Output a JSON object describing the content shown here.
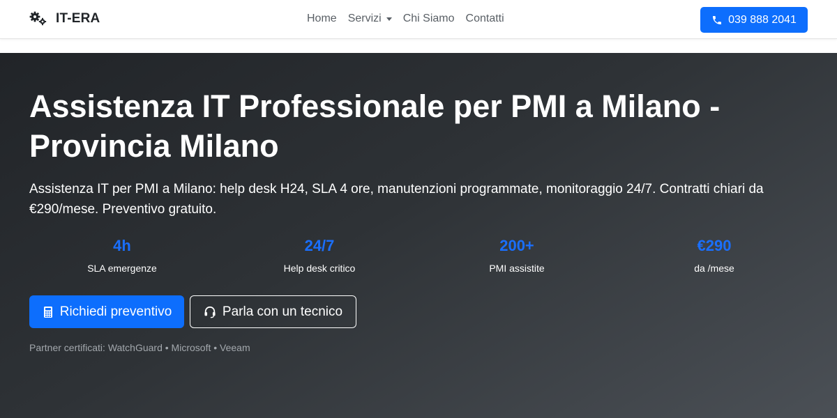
{
  "brand": {
    "name": "IT-ERA",
    "icon": "gears-icon"
  },
  "nav": {
    "home": "Home",
    "servizi": "Servizi",
    "chi_siamo": "Chi Siamo",
    "contatti": "Contatti"
  },
  "phone": {
    "label": "039 888 2041",
    "icon": "phone-icon"
  },
  "hero": {
    "title": "Assistenza IT Professionale per PMI a Milano - Provincia Milano",
    "subtitle": "Assistenza IT per PMI a Milano: help desk H24, SLA 4 ore, manutenzioni programmate, monitoraggio 24/7. Contratti chiari da €290/mese. Preventivo gratuito."
  },
  "stats": [
    {
      "value": "4h",
      "label": "SLA emergenze"
    },
    {
      "value": "24/7",
      "label": "Help desk critico"
    },
    {
      "value": "200+",
      "label": "PMI assistite"
    },
    {
      "value": "€290",
      "label": "da /mese"
    }
  ],
  "cta": {
    "primary": "Richiedi preventivo",
    "primary_icon": "calculator-icon",
    "secondary": "Parla con un tecnico",
    "secondary_icon": "headset-icon"
  },
  "partners": "Partner certificati: WatchGuard • Microsoft • Veeam",
  "colors": {
    "accent": "#0d6efd",
    "stat_value": "#1a6ffd",
    "hero_dark": "#212428",
    "hero_light": "#4b5056",
    "partners_text": "#a3a8ad"
  }
}
